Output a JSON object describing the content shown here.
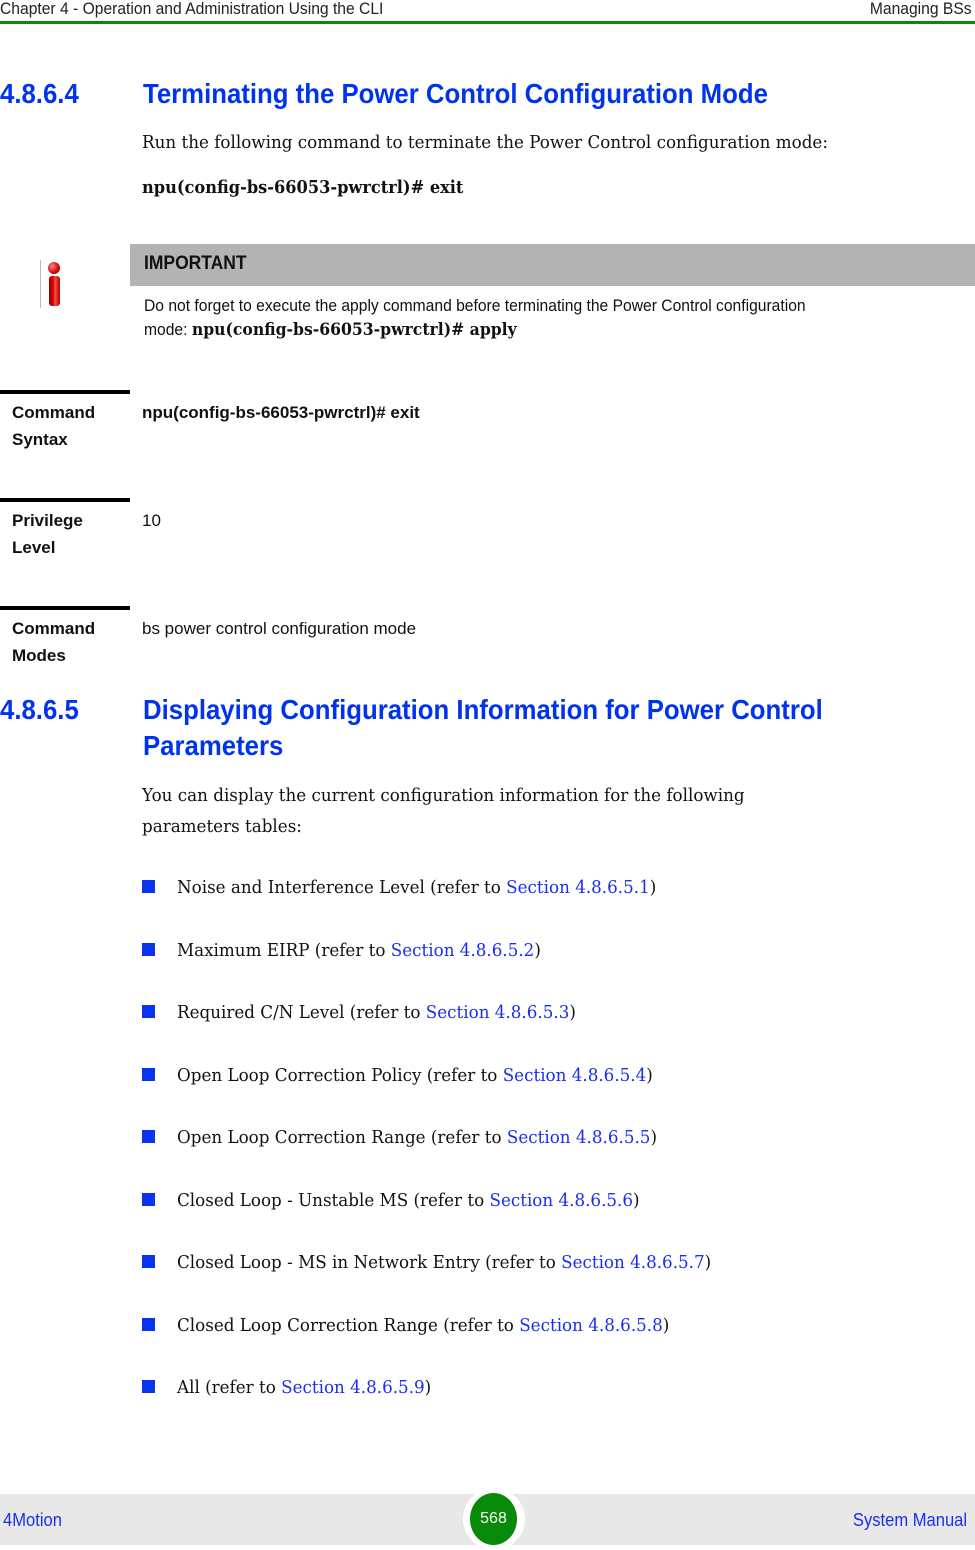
{
  "header": {
    "chapter": "Chapter 4 - Operation and Administration Using the CLI",
    "section": "Managing BSs",
    "rule_color": "#0a8a0a"
  },
  "section1": {
    "number": "4.8.6.4",
    "title": "Terminating the Power Control Configuration Mode",
    "intro": "Run the following command to terminate the Power Control configuration mode:",
    "command_prefix": "npu(config-bs-66053-pwrctrl)#",
    "command_keyword": "exit"
  },
  "note": {
    "icon": "important-info-icon",
    "heading": "IMPORTANT",
    "line1": "Do not forget to execute the apply command before terminating the Power Control configuration",
    "line2_prefix": "mode: ",
    "line2_code": "npu(config-bs-66053-pwrctrl)# apply"
  },
  "command_table": [
    {
      "label": "Command Syntax",
      "value": "npu(config-bs-66053-pwrctrl)# exit",
      "bold": true
    },
    {
      "label": "Privilege Level",
      "value": "10",
      "bold": false
    },
    {
      "label": "Command Modes",
      "value": "bs power control configuration mode",
      "bold": false
    }
  ],
  "section2": {
    "number": "4.8.6.5",
    "title": "Displaying Configuration Information for Power Control Parameters",
    "intro_line1": "You can display the current configuration information for the following",
    "intro_line2": "parameters tables:",
    "items": [
      {
        "text": "Noise and Interference Level (refer to ",
        "link": "Section 4.8.6.5.1",
        "suffix": ")"
      },
      {
        "text": "Maximum EIRP (refer to ",
        "link": "Section 4.8.6.5.2",
        "suffix": ")"
      },
      {
        "text": "Required C/N Level (refer to ",
        "link": "Section 4.8.6.5.3",
        "suffix": ")"
      },
      {
        "text": "Open Loop Correction Policy (refer to ",
        "link": "Section 4.8.6.5.4",
        "suffix": ")"
      },
      {
        "text": "Open Loop Correction Range (refer to ",
        "link": "Section 4.8.6.5.5",
        "suffix": ")"
      },
      {
        "text": "Closed Loop - Unstable MS (refer to ",
        "link": "Section 4.8.6.5.6",
        "suffix": ")"
      },
      {
        "text": "Closed Loop - MS in Network Entry (refer to ",
        "link": "Section 4.8.6.5.7",
        "suffix": ")"
      },
      {
        "text": "Closed Loop Correction Range (refer to ",
        "link": "Section 4.8.6.5.8",
        "suffix": ")"
      },
      {
        "text": "All (refer to ",
        "link": "Section 4.8.6.5.9",
        "suffix": ")"
      }
    ]
  },
  "footer": {
    "product": "4Motion",
    "page_number": "568",
    "document": "System Manual"
  },
  "colors": {
    "heading": "#0033ee",
    "link": "#1a2ef0",
    "bullet": "#0a33f0",
    "note_header_bg": "#b3b3b3",
    "footer_bg": "#e8e8e8",
    "page_badge": "#078a07"
  }
}
